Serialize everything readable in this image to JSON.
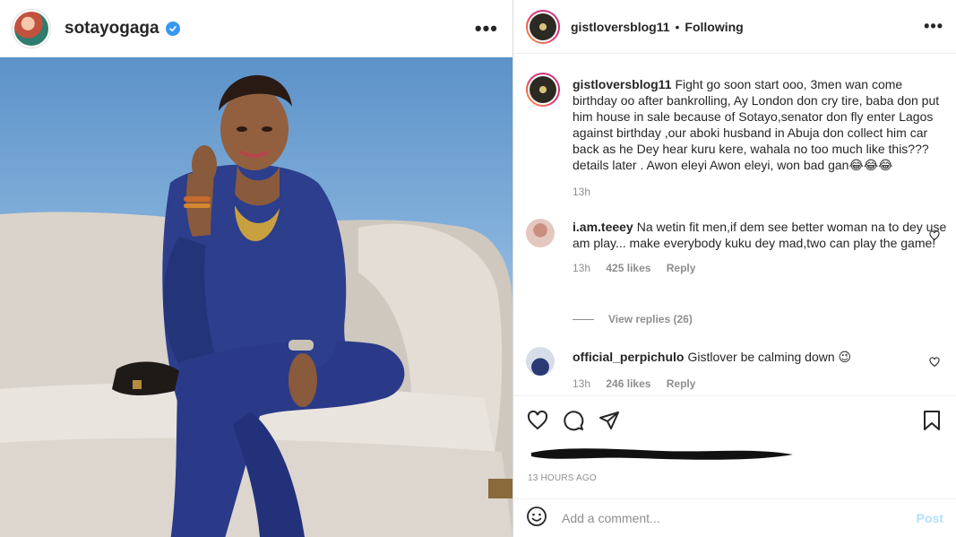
{
  "left_post": {
    "username": "sotayogaga",
    "verified_icon": "verified-badge-icon",
    "more_icon": "more-options-icon"
  },
  "right_panel": {
    "username": "gistloversblog11",
    "separator": "•",
    "follow_status": "Following",
    "more_icon": "more-options-icon"
  },
  "caption": {
    "username": "gistloversblog11",
    "text": "Fight go soon start ooo, 3men wan come birthday oo after bankrolling, Ay London don cry tire, baba don put him house in sale because of Sotayo,senator don fly enter Lagos against birthday ,our aboki husband in Abuja don collect him car back as he Dey hear kuru kere, wahala no too much like this???details later . Awon eleyi Awon eleyi, won bad gan😂😂😂",
    "time": "13h"
  },
  "comments": [
    {
      "username": "i.am.teeey",
      "text": "Na wetin fit men,if dem see better woman na to dey use am play... make everybody kuku dey mad,two can play the game!",
      "time": "13h",
      "likes": "425 likes",
      "reply": "Reply"
    },
    {
      "username": "official_perpichulo",
      "text": "Gistlover be calming down 😉",
      "time": "13h",
      "likes": "246 likes",
      "reply": "Reply"
    }
  ],
  "view_replies": "View replies (26)",
  "actions": {
    "like_icon": "heart-icon",
    "comment_icon": "comment-icon",
    "share_icon": "share-icon",
    "save_icon": "bookmark-icon"
  },
  "timestamp": "13 HOURS AGO",
  "add_comment": {
    "placeholder": "Add a comment...",
    "post_label": "Post",
    "emoji_icon": "emoji-icon"
  },
  "colors": {
    "link_blue": "#3897f0",
    "post_disabled": "#b2dffc",
    "muted": "#8e8e8e",
    "text": "#262626"
  }
}
